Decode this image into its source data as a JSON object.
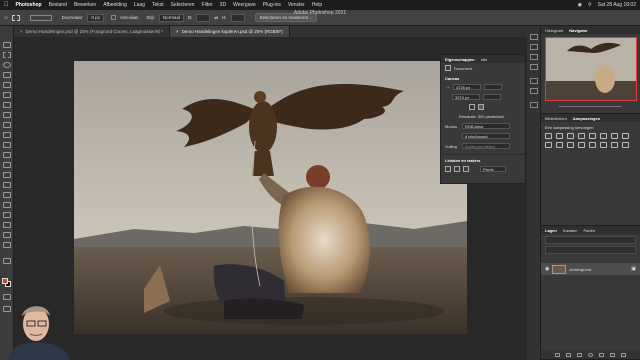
{
  "menubar": {
    "app": "Photoshop",
    "items": [
      "Bestand",
      "Bewerken",
      "Afbeelding",
      "Laag",
      "Tekst",
      "Selecteren",
      "Filter",
      "3D",
      "Weergave",
      "Plug-ins",
      "Venster",
      "Help"
    ],
    "clock": "Sat 28 Aug 18:02"
  },
  "window_title": "Adobe Photoshop 2021",
  "options": {
    "doezelaar_label": "Doezelaar:",
    "doezelaar_value": "0 px",
    "antialias_label": "Anti-alias",
    "stijl_label": "Stijl:",
    "stijl_value": "Normaal",
    "breedte_label": "B:",
    "hoogte_label": "H:",
    "select_mask_button": "Selecteren en maskeren..."
  },
  "tabs": [
    {
      "label": "Demo Handelingen.psd @ 25% (Fotogrond Curves, Laagmasker/8) *",
      "active": false
    },
    {
      "label": "Demo Handelingen kopiëren.psd @ 25% (RGB/8*)",
      "active": true
    }
  ],
  "properties": {
    "tab_active": "Eigenschappen",
    "tab_other": "Info",
    "doc_label": "Document",
    "canvas_section": "Canvas",
    "width": "4725 px",
    "height": "3373 px",
    "resolution": "Resolutie: 300 pixels/inch",
    "mode_label": "Modus",
    "mode_value": "RGB-kleur",
    "bits_value": "8 bits/kanaal",
    "fill_label": "Vulling",
    "fill_value": "Achtergrondkleur",
    "rulers_section": "Linialen en rasters",
    "pixels_value": "Pixels"
  },
  "right_panels": {
    "nav_tabs": [
      "Histogram",
      "Navigator"
    ],
    "adj_tabs": [
      "Bibliotheken",
      "Aanpassingen"
    ],
    "adj_hint": "Een aanpassing toevoegen",
    "layers_tabs": [
      "Lagen",
      "Kanalen",
      "Paden"
    ],
    "layer_name": "Achtergrond"
  },
  "colors": {
    "accent_red": "#e03b3b",
    "foreground": "#c44a1b",
    "background": "#111111"
  }
}
